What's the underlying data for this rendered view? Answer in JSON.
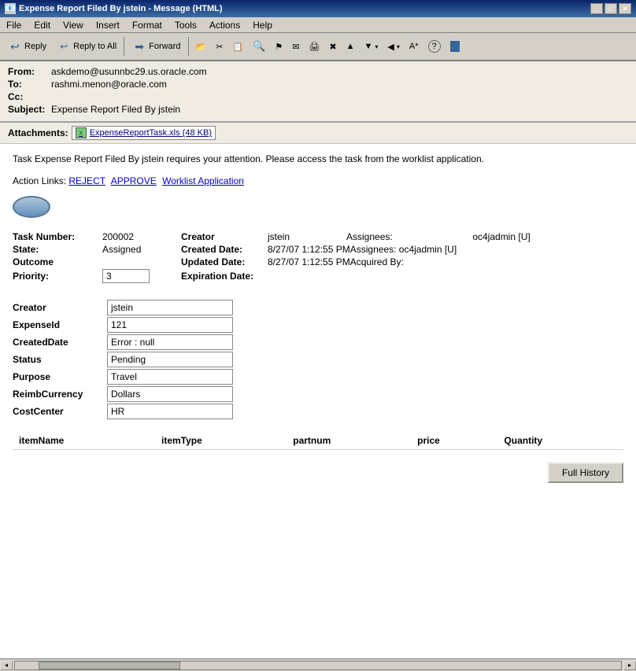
{
  "window": {
    "title": "Expense Report Filed By jstein - Message (HTML)",
    "controls": [
      "_",
      "□",
      "×"
    ]
  },
  "menubar": {
    "items": [
      "File",
      "Edit",
      "View",
      "Insert",
      "Format",
      "Tools",
      "Actions",
      "Help"
    ]
  },
  "toolbar": {
    "buttons": [
      {
        "label": "Reply",
        "name": "reply-button",
        "icon": "↩"
      },
      {
        "label": "Reply to All",
        "name": "reply-all-button",
        "icon": "↩↩"
      },
      {
        "label": "Forward",
        "name": "forward-button",
        "icon": "→"
      }
    ],
    "extra_icons": [
      "📁",
      "✂",
      "📋",
      "🔍",
      "⚑",
      "📬",
      "🖨",
      "✖",
      "▲",
      "▼",
      "◀",
      "▶",
      "A*",
      "?"
    ]
  },
  "email": {
    "from_label": "From:",
    "from_value": "askdemo@usunnbc29.us.oracle.com",
    "to_label": "To:",
    "to_value": "rashmi.menon@oracle.com",
    "cc_label": "Cc:",
    "cc_value": "",
    "subject_label": "Subject:",
    "subject_value": "Expense Report Filed By jstein",
    "attachments_label": "Attachments:",
    "attachment_file": "ExpenseReportTask.xls (48 KB)"
  },
  "body": {
    "main_text": "Task Expense Report Filed By jstein requires your attention. Please access the task from the worklist application.",
    "action_links_label": "Action Links:",
    "actions": [
      "REJECT",
      "APPROVE",
      "Worklist Application"
    ]
  },
  "task_details": {
    "task_number_label": "Task Number:",
    "task_number_value": "200002",
    "state_label": "State:",
    "state_value": "Assigned",
    "outcome_label": "Outcome",
    "priority_label": "Priority:",
    "priority_value": "3",
    "creator_label": "Creator",
    "creator_value": "jstein",
    "created_date_label": "Created Date:",
    "created_date_value": "8/27/07 1:12:55 PM",
    "updated_date_label": "Updated Date:",
    "updated_date_value": "8/27/07 1:12:55 PM",
    "expiration_date_label": "Expiration Date:",
    "expiration_date_value": "",
    "assignees_label": "Assignees:",
    "assignees_value": "oc4jadmin [U]",
    "acquired_by_label": "Acquired By:",
    "acquired_by_value": ""
  },
  "form_fields": [
    {
      "label": "Creator",
      "value": "jstein"
    },
    {
      "label": "ExpenseId",
      "value": "121"
    },
    {
      "label": "CreatedDate",
      "value": "Error : null"
    },
    {
      "label": "Status",
      "value": "Pending"
    },
    {
      "label": "Purpose",
      "value": "Travel"
    },
    {
      "label": "ReimbCurrency",
      "value": "Dollars"
    },
    {
      "label": "CostCenter",
      "value": "HR"
    }
  ],
  "table": {
    "columns": [
      "itemName",
      "itemType",
      "partnum",
      "price",
      "Quantity"
    ],
    "rows": []
  },
  "buttons": {
    "full_history": "Full History"
  }
}
